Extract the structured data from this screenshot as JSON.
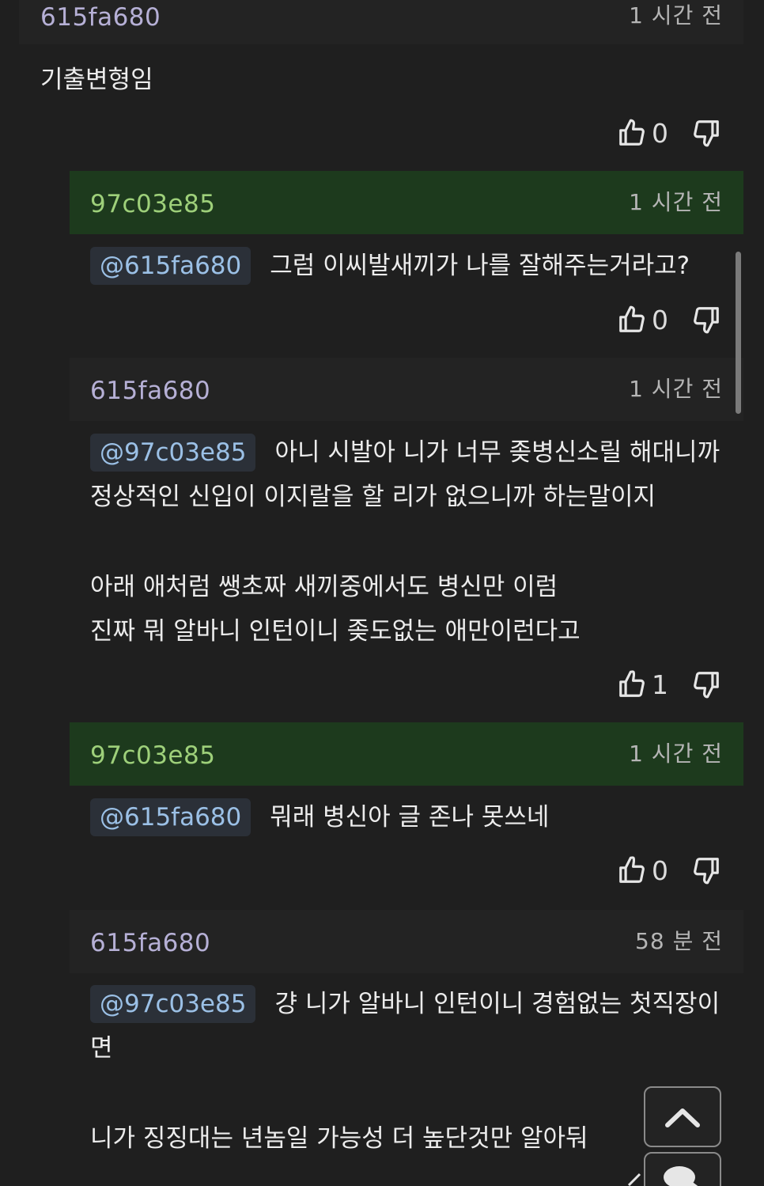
{
  "comments": [
    {
      "author": "615fa680",
      "time": "1 시간 전",
      "text": "기출변형임",
      "up": "0"
    },
    {
      "author": "97c03e85",
      "time": "1 시간 전",
      "mention": "@615fa680",
      "text": "그럼 이씨발새끼가 나를 잘해주는거라고?",
      "up": "0"
    },
    {
      "author": "615fa680",
      "time": "1 시간 전",
      "mention": "@97c03e85",
      "line1": "아니 시발아 니가 너무 좆병신소릴 해대니까",
      "line2": "정상적인 신입이 이지랄을 할 리가 없으니까 하는말이지",
      "line3": "아래 애처럼 쌩초짜 새끼중에서도 병신만 이럼",
      "line4": "진짜 뭐 알바니 인턴이니 좆도없는 애만이런다고",
      "up": "1"
    },
    {
      "author": "97c03e85",
      "time": "1 시간 전",
      "mention": "@615fa680",
      "text": "뭐래 병신아 글 존나 못쓰네",
      "up": "0"
    },
    {
      "author": "615fa680",
      "time": "58 분 전",
      "mention": "@97c03e85",
      "line1": "걍 니가 알바니 인턴이니 경험없는 첫직장이",
      "line2": "면",
      "line3": "니가 징징대는 년놈일 가능성 더 높단것만 알아둬"
    }
  ],
  "icons": {
    "thumb_up": "thumb-up-icon",
    "thumb_down": "thumb-down-icon",
    "scroll_top": "chevron-up-icon",
    "chat": "chat-icon"
  },
  "colors": {
    "background": "#1f1f1f",
    "reply_band_green": "#1d3a1d",
    "author_purple": "#b6b0d6",
    "author_green": "#9ed07a",
    "mention_text": "#9bc0e6"
  }
}
